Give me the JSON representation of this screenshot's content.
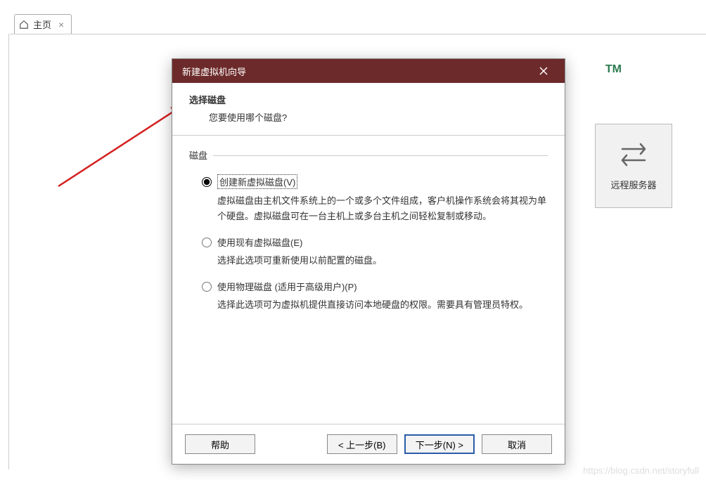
{
  "tab": {
    "label": "主页"
  },
  "tm": "TM",
  "side_card": {
    "label": "远程服务器"
  },
  "watermark": "https://blog.csdn.net/storyfull",
  "dialog": {
    "title": "新建虚拟机向导",
    "header_title": "选择磁盘",
    "header_subtitle": "您要使用哪个磁盘?",
    "group_label": "磁盘",
    "options": [
      {
        "label": "创建新虚拟磁盘(V)",
        "desc": "虚拟磁盘由主机文件系统上的一个或多个文件组成，客户机操作系统会将其视为单个硬盘。虚拟磁盘可在一台主机上或多台主机之间轻松复制或移动。",
        "selected": true
      },
      {
        "label": "使用现有虚拟磁盘(E)",
        "desc": "选择此选项可重新使用以前配置的磁盘。",
        "selected": false
      },
      {
        "label": "使用物理磁盘 (适用于高级用户)(P)",
        "desc": "选择此选项可为虚拟机提供直接访问本地硬盘的权限。需要具有管理员特权。",
        "selected": false
      }
    ],
    "buttons": {
      "help": "帮助",
      "back": "< 上一步(B)",
      "next": "下一步(N) >",
      "cancel": "取消"
    }
  }
}
